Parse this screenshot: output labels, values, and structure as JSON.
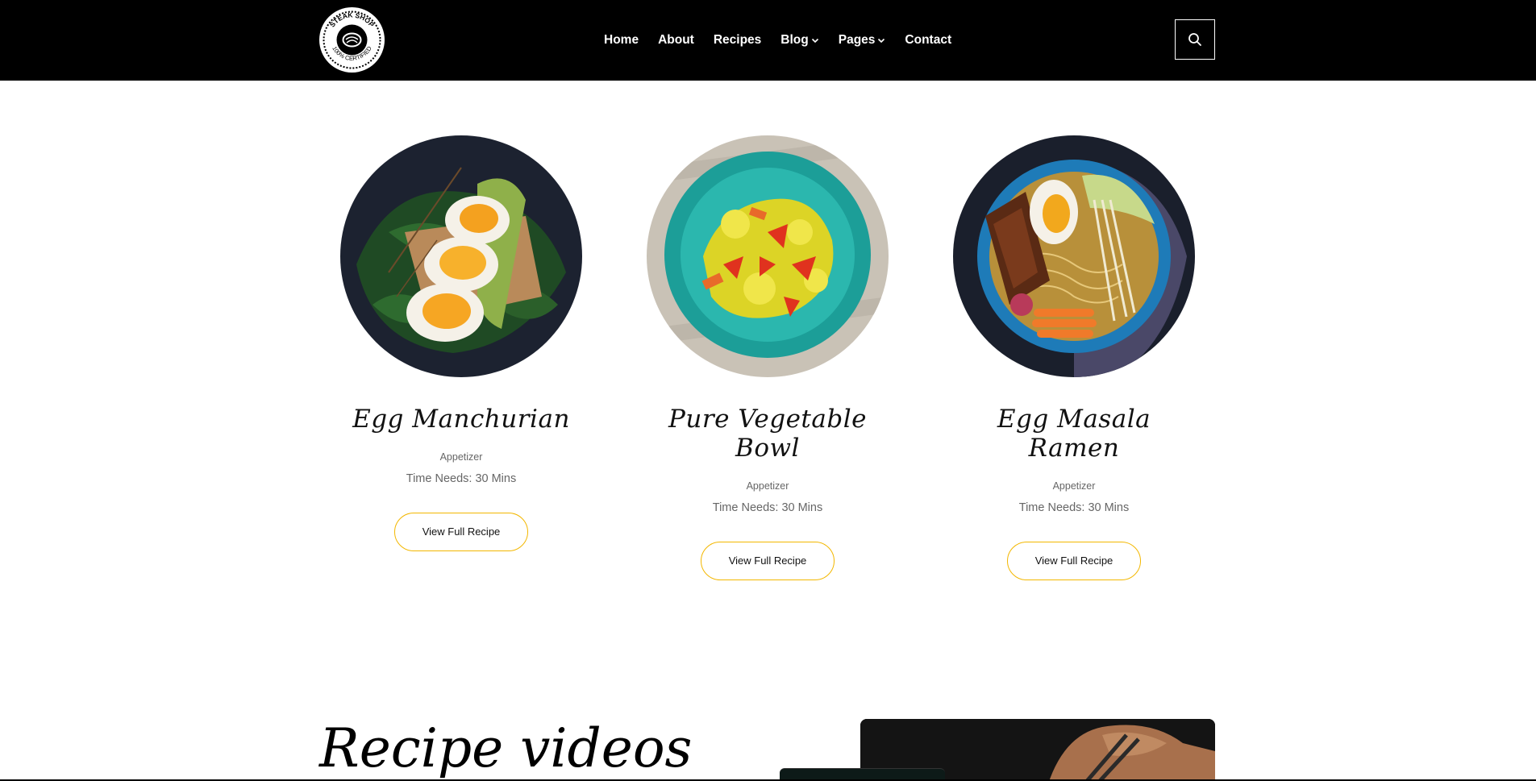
{
  "header": {
    "logo": {
      "icon": "steak-shop-badge",
      "alt_text": "STEAK SHOP 100% CERTIFIED"
    },
    "nav": [
      {
        "label": "Home",
        "has_dropdown": false
      },
      {
        "label": "About",
        "has_dropdown": false
      },
      {
        "label": "Recipes",
        "has_dropdown": false
      },
      {
        "label": "Blog",
        "has_dropdown": true
      },
      {
        "label": "Pages",
        "has_dropdown": true
      },
      {
        "label": "Contact",
        "has_dropdown": false
      }
    ],
    "search_icon": "search-icon"
  },
  "recipes": [
    {
      "title": "Egg Manchurian",
      "category": "Appetizer",
      "time": "Time Needs: 30 Mins",
      "button": "View Full Recipe",
      "image": "eggs-avocado-spinach-toast"
    },
    {
      "title": "Pure Vegetable Bowl",
      "category": "Appetizer",
      "time": "Time Needs: 30 Mins",
      "button": "View Full Recipe",
      "image": "vegetable-salad-teal-bowl"
    },
    {
      "title": "Egg Masala Ramen",
      "category": "Appetizer",
      "time": "Time Needs: 30 Mins",
      "button": "View Full Recipe",
      "image": "ramen-egg-blue-bowl"
    }
  ],
  "videos": {
    "title": "Recipe videos"
  },
  "colors": {
    "header_bg": "#000000",
    "accent": "#f3b700",
    "muted_text": "#666666"
  }
}
